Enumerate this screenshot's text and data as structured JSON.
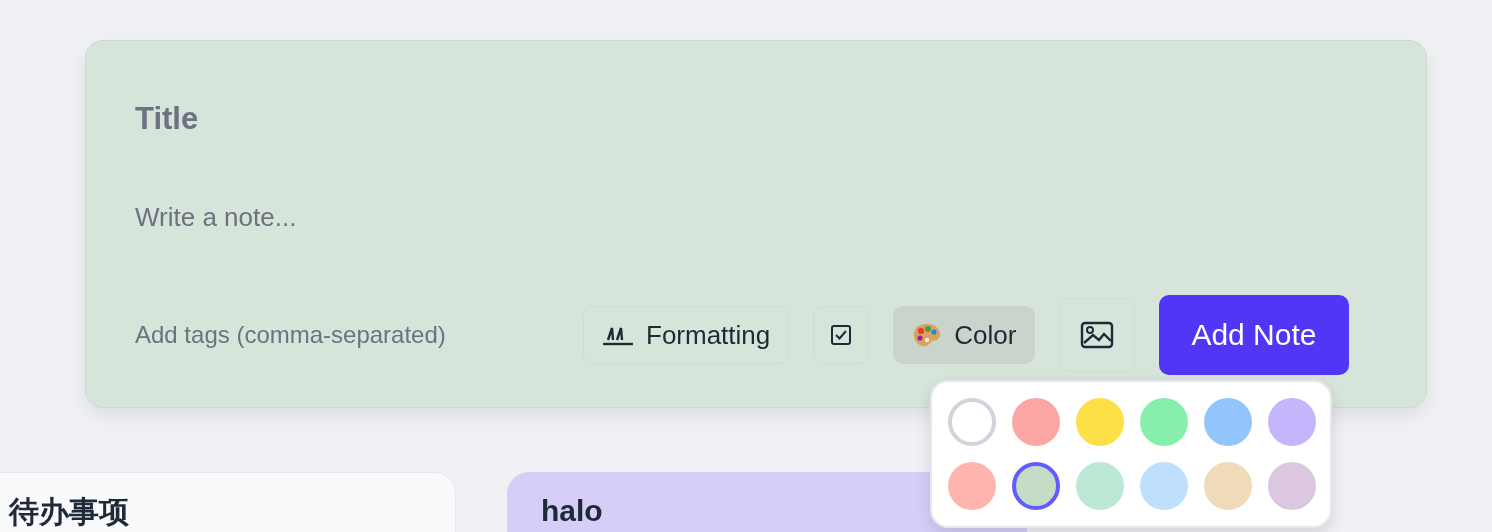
{
  "composer": {
    "title_placeholder": "Title",
    "note_placeholder": "Write a note...",
    "tags_placeholder": "Add tags (comma-separated)",
    "toolbar": [
      {
        "kind": "formatting",
        "label": "Formatting",
        "selected": false
      },
      {
        "kind": "checklist",
        "selected": false
      },
      {
        "kind": "color",
        "label": "Color",
        "selected": true
      },
      {
        "kind": "image",
        "selected": false
      }
    ],
    "submit": "Add Note"
  },
  "color_picker": [
    {
      "color": "#ffffff",
      "selected": false
    },
    {
      "color": "#fca5a5",
      "selected": false
    },
    {
      "color": "#fde047",
      "selected": false
    },
    {
      "color": "#86efac",
      "selected": false
    },
    {
      "color": "#93c5fd",
      "selected": false
    },
    {
      "color": "#c4b5fd",
      "selected": false
    },
    {
      "color": "#ffb5ae",
      "selected": false
    },
    {
      "color": "#c5dcc6",
      "selected": true
    },
    {
      "color": "#bbe9d5",
      "selected": false
    },
    {
      "color": "#bfe0fc",
      "selected": false
    },
    {
      "color": "#f0dab7",
      "selected": false
    },
    {
      "color": "#dcc7e0",
      "selected": false
    }
  ],
  "notes": [
    {
      "title": "待办事项",
      "color": "#f9fafb"
    },
    {
      "title": "halo",
      "color": "#d6cef8"
    }
  ]
}
